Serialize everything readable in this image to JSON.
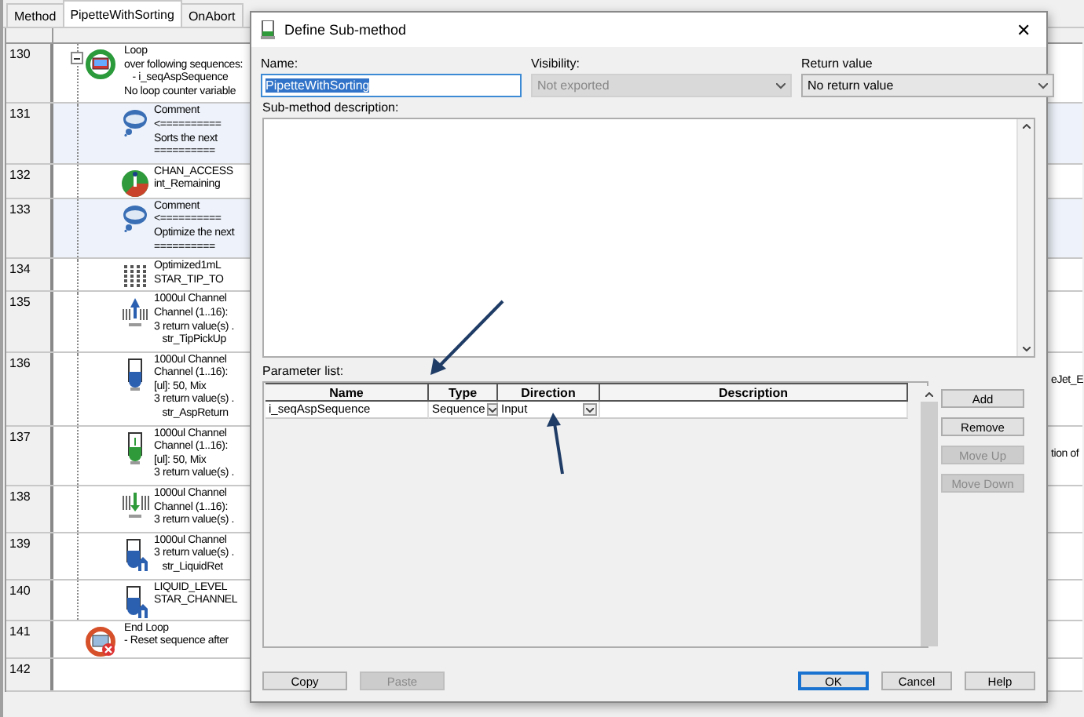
{
  "tabs": [
    {
      "label": "Method",
      "selected": false
    },
    {
      "label": "PipetteWithSorting",
      "selected": true
    },
    {
      "label": "OnAbort",
      "selected": false
    }
  ],
  "steps": [
    {
      "number": "130",
      "kind": "loop",
      "tree_toggle": true,
      "lines": [
        "Loop",
        "over following sequences:",
        "   - i_seqAspSequence",
        "No loop counter variable"
      ]
    },
    {
      "number": "131",
      "kind": "comment",
      "highlight": true,
      "lines": [
        "Comment",
        "<==========",
        "Sorts the next",
        "=========="
      ]
    },
    {
      "number": "132",
      "kind": "info",
      "highlight": false,
      "lines": [
        "CHAN_ACCESS",
        "int_Remaining"
      ]
    },
    {
      "number": "133",
      "kind": "comment",
      "highlight": true,
      "lines": [
        "Comment",
        "<==========",
        "Optimize the next",
        "=========="
      ]
    },
    {
      "number": "134",
      "kind": "tiprack",
      "highlight": false,
      "lines": [
        "Optimized1mL",
        "STAR_TIP_TO"
      ]
    },
    {
      "number": "135",
      "kind": "pickup",
      "highlight": false,
      "lines": [
        "1000ul Channel",
        "Channel (1..16):",
        "3 return value(s) .",
        "   str_TipPickUp"
      ]
    },
    {
      "number": "136",
      "kind": "aspirate",
      "highlight": false,
      "lines": [
        "1000ul Channel",
        "Channel (1..16):",
        "[ul]: 50, Mix",
        "3 return value(s) .",
        "   str_AspReturn"
      ],
      "right_fragment": "eJet_E"
    },
    {
      "number": "137",
      "kind": "dispense",
      "highlight": false,
      "lines": [
        "1000ul Channel",
        "Channel (1..16):",
        "[ul]: 50, Mix",
        "3 return value(s) ."
      ],
      "right_fragment": "tion of"
    },
    {
      "number": "138",
      "kind": "eject",
      "highlight": false,
      "lines": [
        "1000ul Channel",
        "Channel (1..16):",
        "3 return value(s) ."
      ]
    },
    {
      "number": "139",
      "kind": "liquid",
      "highlight": false,
      "lines": [
        "1000ul Channel",
        "3 return value(s) .",
        "   str_LiquidRet"
      ]
    },
    {
      "number": "140",
      "kind": "liquid",
      "highlight": false,
      "lines": [
        "LIQUID_LEVEL",
        "STAR_CHANNEL"
      ]
    },
    {
      "number": "141",
      "kind": "endloop",
      "lines": [
        "End Loop",
        "- Reset sequence after"
      ]
    },
    {
      "number": "142",
      "kind": "empty"
    }
  ],
  "dialog": {
    "title": "Define Sub-method",
    "close": "✕",
    "name": {
      "label": "Name:",
      "value": "PipetteWithSorting"
    },
    "visibility": {
      "label": "Visibility:",
      "value": "Not exported",
      "disabled": true
    },
    "return_value": {
      "label": "Return value",
      "value": "No return value",
      "disabled": false
    },
    "description": {
      "label": "Sub-method description:"
    },
    "parameters": {
      "label": "Parameter list:",
      "columns": [
        "Name",
        "Type",
        "Direction",
        "Description"
      ],
      "rows": [
        {
          "name": "i_seqAspSequence",
          "type": "Sequence",
          "direction": "Input"
        }
      ]
    },
    "side_buttons": [
      {
        "label": "Add",
        "disabled": false
      },
      {
        "label": "Remove",
        "disabled": false
      },
      {
        "label": "Move Up",
        "disabled": true
      },
      {
        "label": "Move Down",
        "disabled": true
      }
    ],
    "bottom_left_buttons": [
      {
        "label": "Copy",
        "disabled": false
      },
      {
        "label": "Paste",
        "disabled": true
      }
    ],
    "bottom_right_buttons": [
      {
        "label": "OK",
        "default": true
      },
      {
        "label": "Cancel",
        "default": false
      },
      {
        "label": "Help",
        "default": false
      }
    ]
  }
}
